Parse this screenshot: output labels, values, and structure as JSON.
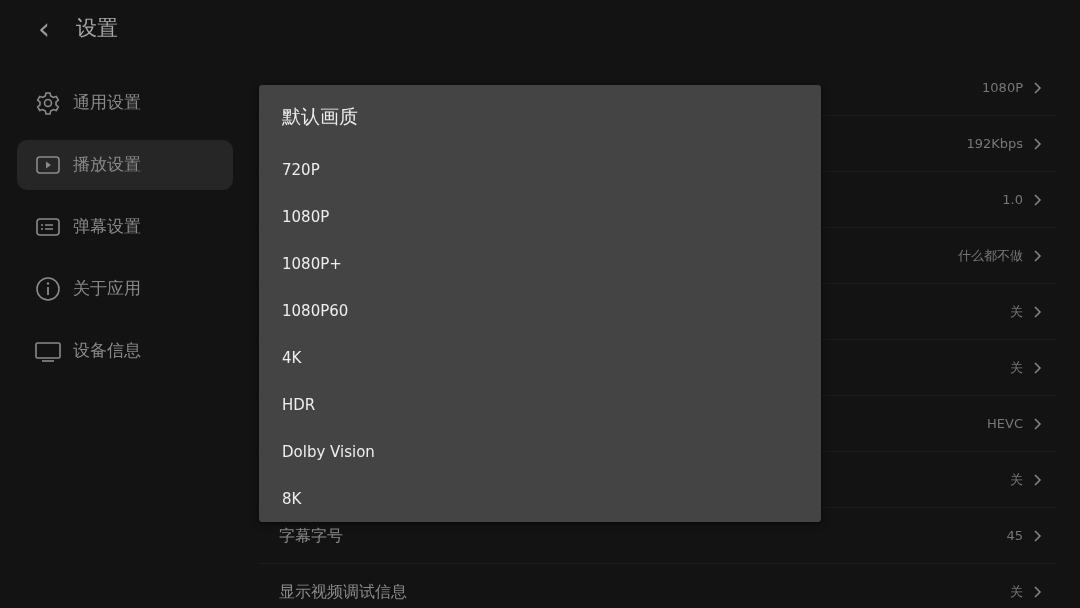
{
  "header": {
    "back": "‹",
    "title": "设置"
  },
  "sidebar": {
    "items": [
      {
        "kind": "gear",
        "label": "通用设置",
        "selected": false
      },
      {
        "kind": "play",
        "label": "播放设置",
        "selected": true
      },
      {
        "kind": "danmaku",
        "label": "弹幕设置",
        "selected": false
      },
      {
        "kind": "info",
        "label": "关于应用",
        "selected": false
      },
      {
        "kind": "tv",
        "label": "设备信息",
        "selected": false
      }
    ]
  },
  "settings": [
    {
      "value": "1080P"
    },
    {
      "value": "192Kbps"
    },
    {
      "value": "1.0"
    },
    {
      "value": "什么都不做"
    },
    {
      "value": "关"
    },
    {
      "value": "关"
    },
    {
      "value": "HEVC"
    },
    {
      "value": "关"
    },
    {
      "label": "字幕字号",
      "value": "45"
    },
    {
      "label": "显示视频调试信息",
      "value": "关"
    }
  ],
  "dialog": {
    "title": "默认画质",
    "options": [
      "720P",
      "1080P",
      "1080P+",
      "1080P60",
      "4K",
      "HDR",
      "Dolby Vision",
      "8K"
    ]
  }
}
